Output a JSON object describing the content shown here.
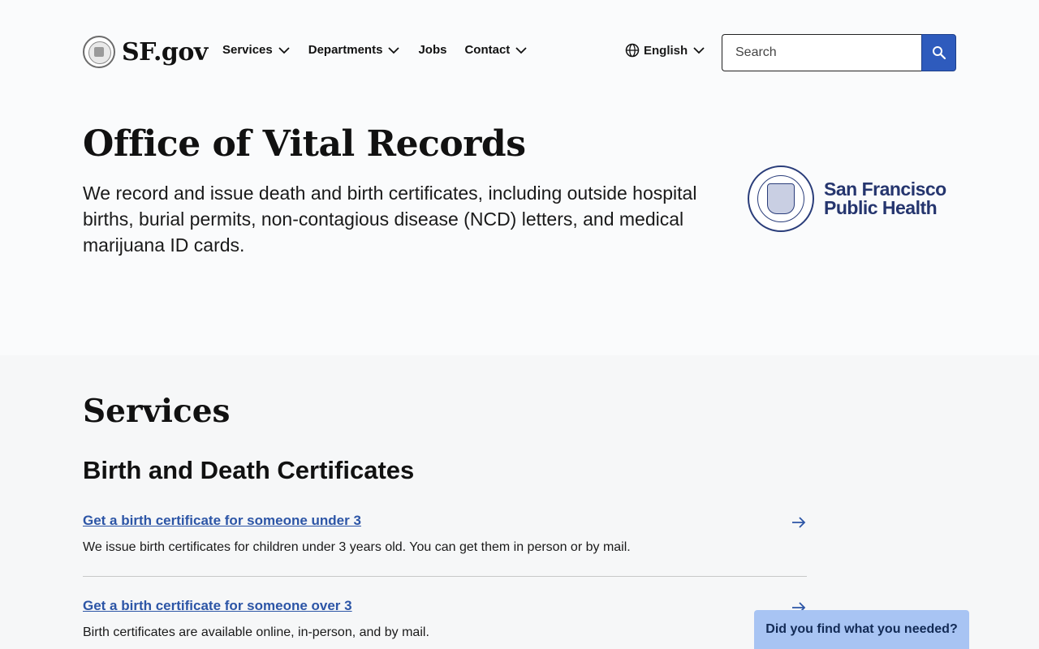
{
  "header": {
    "logo_text": "SF.gov",
    "nav": [
      {
        "label": "Services",
        "has_dropdown": true
      },
      {
        "label": "Departments",
        "has_dropdown": true
      },
      {
        "label": "Jobs",
        "has_dropdown": false
      },
      {
        "label": "Contact",
        "has_dropdown": true
      }
    ],
    "language": "English",
    "search": {
      "placeholder": "Search"
    }
  },
  "hero": {
    "title": "Office of Vital Records",
    "description": "We record and issue death and birth certificates, including outside hospital births, burial permits, non-contagious disease (NCD) letters, and medical marijuana ID cards.",
    "partner_logo": {
      "line1": "San Francisco",
      "line2": "Public Health"
    }
  },
  "services": {
    "title": "Services",
    "subsection_title": "Birth and Death Certificates",
    "items": [
      {
        "link": "Get a birth certificate for someone under 3",
        "description": "We issue birth certificates for children under 3 years old. You can get them in person or by mail."
      },
      {
        "link": "Get a birth certificate for someone over 3",
        "description": "Birth certificates are available online, in-person, and by mail."
      }
    ]
  },
  "feedback": {
    "label": "Did you find what you needed?"
  },
  "colors": {
    "accent": "#2e5bbd",
    "link": "#2c55a6",
    "feedback_bg": "#a8c4f3",
    "brand_navy": "#25356e"
  }
}
